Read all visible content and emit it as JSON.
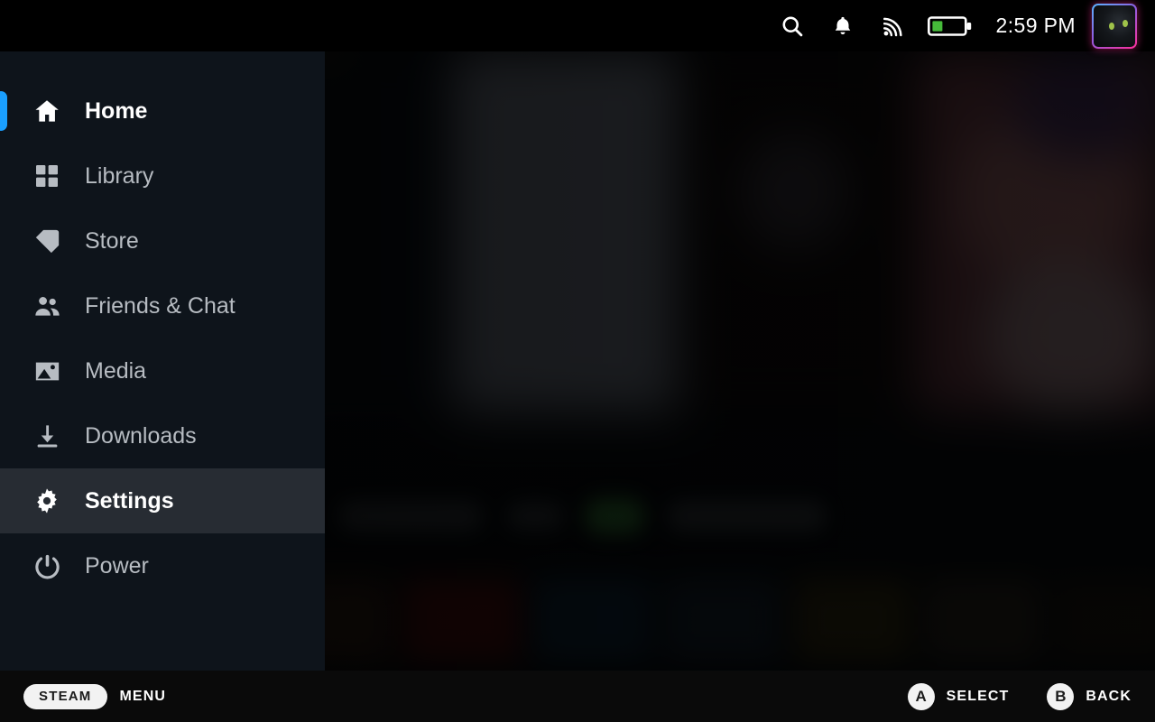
{
  "statusbar": {
    "icons": [
      {
        "name": "search-icon",
        "label": "Search"
      },
      {
        "name": "notifications-bell-icon",
        "label": "Notifications"
      },
      {
        "name": "wifi-signal-icon",
        "label": "Wi-Fi"
      },
      {
        "name": "battery-icon",
        "label": "Battery"
      }
    ],
    "battery_percent": 30,
    "battery_fill_color": "#46bb3a",
    "time": "2:59 PM",
    "avatar_label": "User avatar"
  },
  "sidebar": {
    "items": [
      {
        "label": "Home",
        "icon": "home-icon",
        "state": "focused"
      },
      {
        "label": "Library",
        "icon": "library-icon",
        "state": "normal"
      },
      {
        "label": "Store",
        "icon": "store-tag-icon",
        "state": "normal"
      },
      {
        "label": "Friends & Chat",
        "icon": "friends-icon",
        "state": "normal"
      },
      {
        "label": "Media",
        "icon": "media-image-icon",
        "state": "normal"
      },
      {
        "label": "Downloads",
        "icon": "download-icon",
        "state": "normal"
      },
      {
        "label": "Settings",
        "icon": "gear-icon",
        "state": "selected"
      },
      {
        "label": "Power",
        "icon": "power-icon",
        "state": "normal"
      }
    ],
    "focus_accent_color": "#1a9fff",
    "selected_background_color": "#272c33",
    "background_color": "#0e141b"
  },
  "bottombar": {
    "steam_pill": "STEAM",
    "menu_label": "MENU",
    "buttons": [
      {
        "glyph": "A",
        "label": "SELECT"
      },
      {
        "glyph": "B",
        "label": "BACK"
      }
    ]
  }
}
